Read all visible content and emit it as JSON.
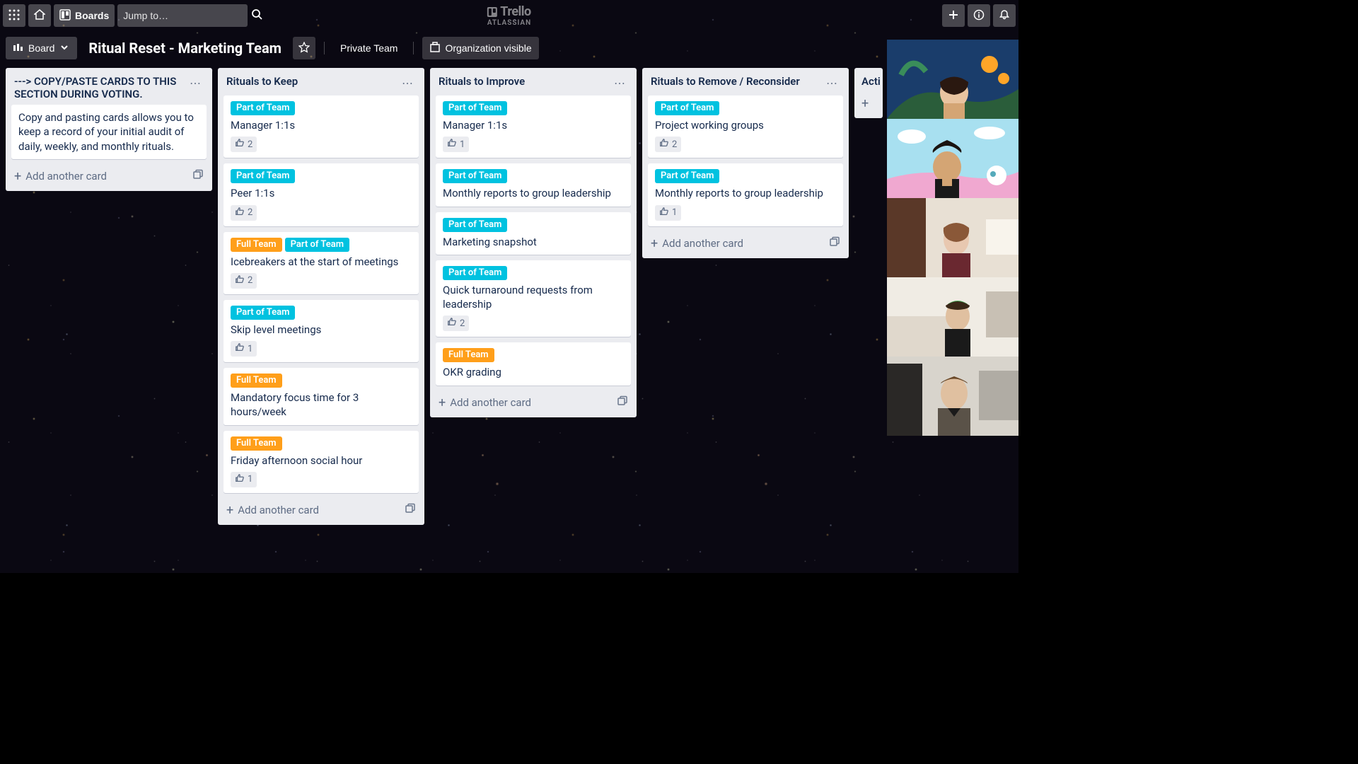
{
  "topbar": {
    "boards_label": "Boards",
    "search_placeholder": "Jump to…"
  },
  "logo": {
    "brand": "Trello",
    "company": "ATLASSIAN"
  },
  "boardbar": {
    "view_label": "Board",
    "title": "Ritual Reset - Marketing Team",
    "team_label": "Private Team",
    "visibility_label": "Organization visible"
  },
  "labels": {
    "part_of_team": "Part of Team",
    "full_team": "Full Team"
  },
  "add_card_label": "Add another card",
  "lists": [
    {
      "title": "---> COPY/PASTE CARDS TO THIS SECTION DURING VOTING.",
      "cards": [
        {
          "text": "Copy and pasting cards allows you to keep a record of your initial audit of daily, weekly, and monthly rituals."
        }
      ]
    },
    {
      "title": "Rituals to Keep",
      "cards": [
        {
          "labels": [
            "team"
          ],
          "text": "Manager 1:1s",
          "votes": 2
        },
        {
          "labels": [
            "team"
          ],
          "text": "Peer 1:1s",
          "votes": 2
        },
        {
          "labels": [
            "full",
            "team"
          ],
          "text": "Icebreakers at the start of meetings",
          "votes": 2
        },
        {
          "labels": [
            "team"
          ],
          "text": "Skip level meetings",
          "votes": 1
        },
        {
          "labels": [
            "full"
          ],
          "text": "Mandatory focus time for 3 hours/week"
        },
        {
          "labels": [
            "full"
          ],
          "text": "Friday afternoon social hour",
          "votes": 1
        }
      ]
    },
    {
      "title": "Rituals to Improve",
      "cards": [
        {
          "labels": [
            "team"
          ],
          "text": "Manager 1:1s",
          "votes": 1
        },
        {
          "labels": [
            "team"
          ],
          "text": "Monthly reports to group leadership"
        },
        {
          "labels": [
            "team"
          ],
          "text": "Marketing snapshot"
        },
        {
          "labels": [
            "team"
          ],
          "text": "Quick turnaround requests from leadership",
          "votes": 2
        },
        {
          "labels": [
            "full"
          ],
          "text": "OKR grading"
        }
      ]
    },
    {
      "title": "Rituals to Remove / Reconsider",
      "cards": [
        {
          "labels": [
            "team"
          ],
          "text": "Project working groups",
          "votes": 2
        },
        {
          "labels": [
            "team"
          ],
          "text": "Monthly reports to group leadership",
          "votes": 1
        }
      ]
    },
    {
      "title": "Acti",
      "cards": []
    }
  ]
}
